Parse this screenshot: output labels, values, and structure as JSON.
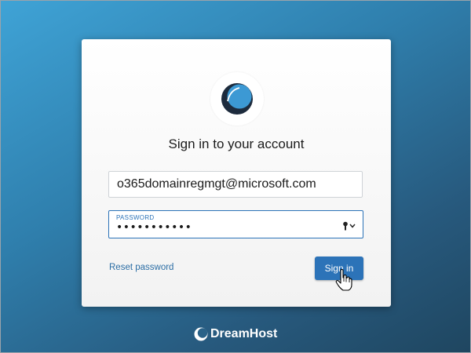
{
  "login": {
    "title": "Sign in to your account",
    "email_value": "o365domainregmgt@microsoft.com",
    "password_label": "PASSWORD",
    "password_masked": "•••••••••••",
    "reset_link": "Reset password",
    "signin_button": "Sign in"
  },
  "brand": {
    "name": "DreamHost",
    "logo_icon": "dreamhost-moon-icon"
  },
  "colors": {
    "accent": "#2c73b8",
    "logo_dark": "#1d2b3d",
    "logo_light": "#3c99d4",
    "background_start": "#3fa3d6",
    "background_end": "#1f4660"
  }
}
